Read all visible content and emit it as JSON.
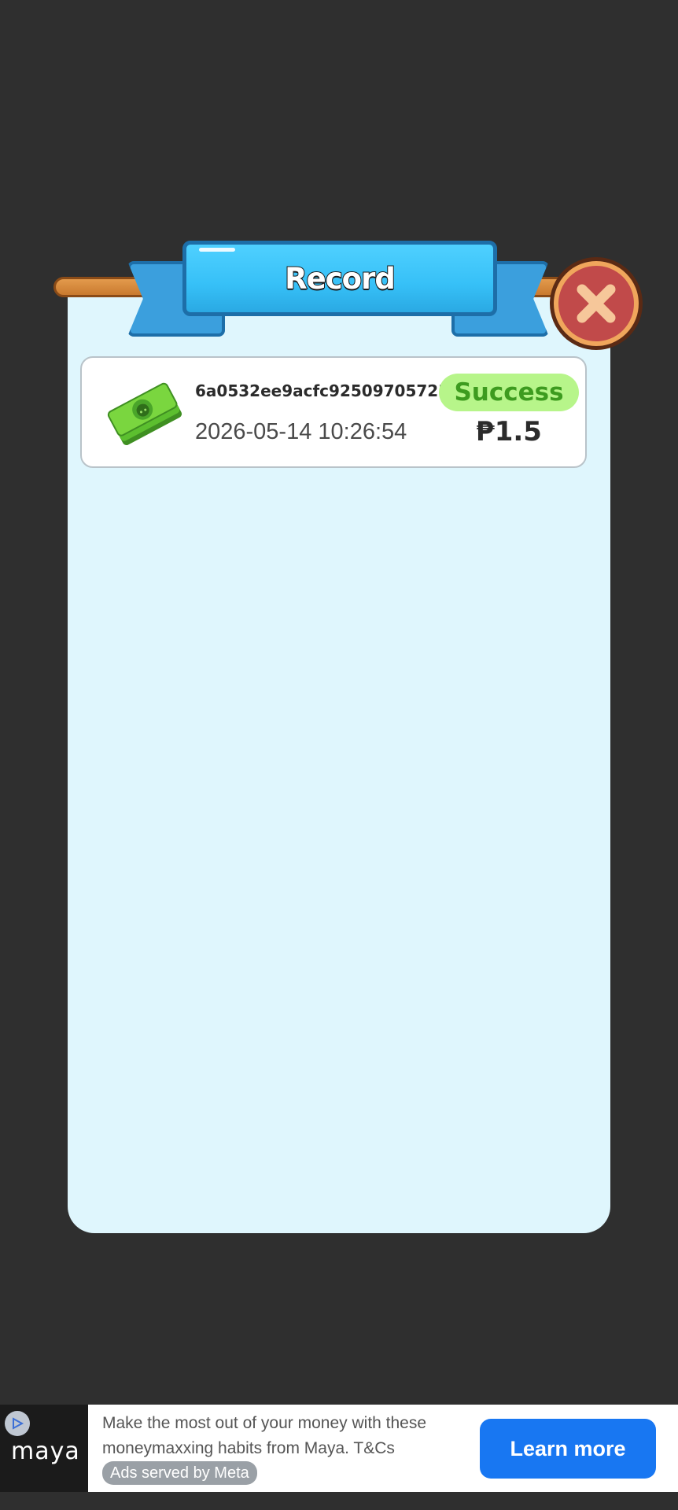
{
  "dialog": {
    "title": "Record"
  },
  "records": [
    {
      "id": "6a0532ee9acfc92509705723",
      "time": "2026-05-14 10:26:54",
      "status": "Success",
      "amount": "₱1.5",
      "icon": "money-bill-icon"
    }
  ],
  "ad": {
    "brand": "maya",
    "text": "Make the most out of your money with these moneymaxxing habits from Maya. T&Cs",
    "tag": "Ads served by Meta",
    "cta": "Learn more",
    "cta_color": "#1877f2"
  },
  "colors": {
    "background": "#2f2f2f",
    "panel": "#dff6fd",
    "ribbon": "#36c0f7",
    "success_badge": "#b7f58a",
    "success_text": "#3d9b1f",
    "close_button": "#c14a4a"
  }
}
